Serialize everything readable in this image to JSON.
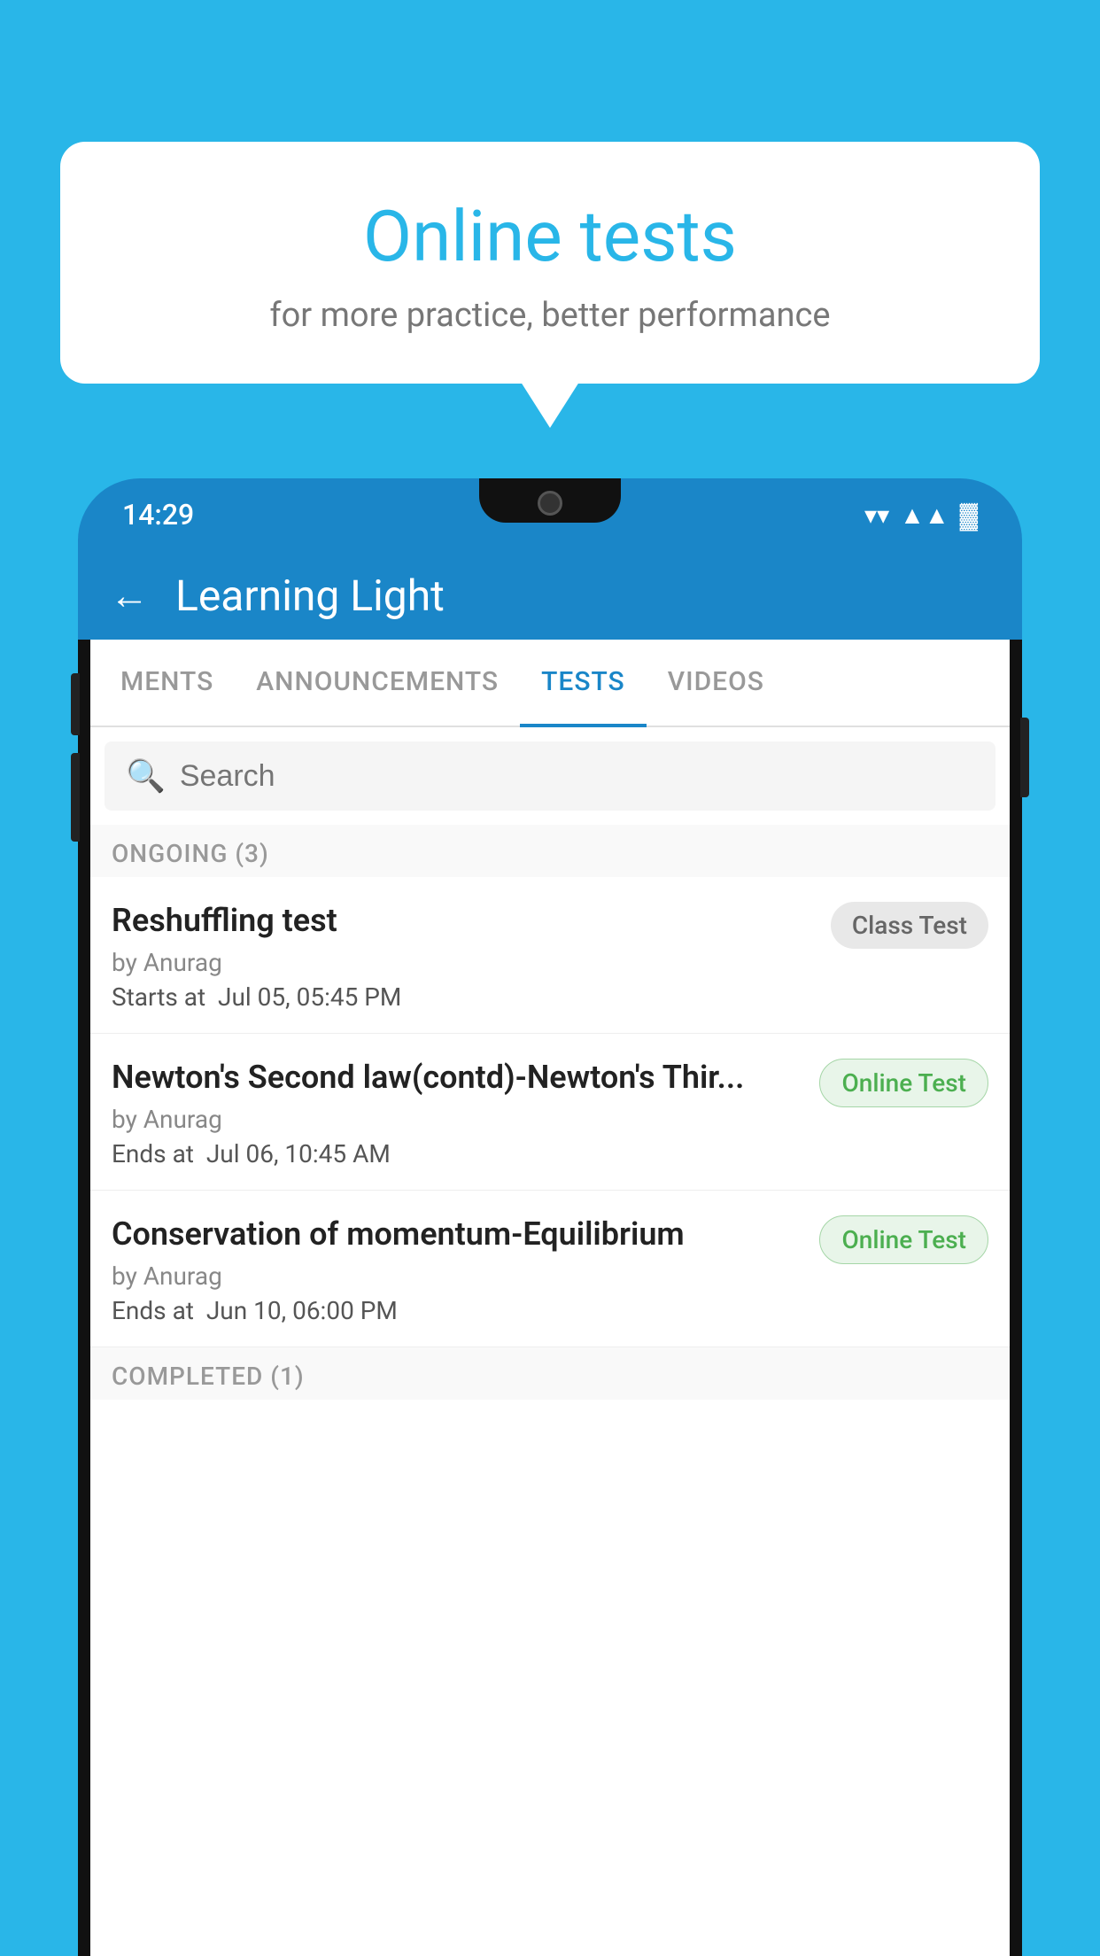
{
  "bubble": {
    "title": "Online tests",
    "subtitle": "for more practice, better performance"
  },
  "phone": {
    "status": {
      "time": "14:29",
      "wifi": "▼",
      "signal": "▲",
      "battery": "▐"
    },
    "header": {
      "back_label": "←",
      "app_name": "Learning Light"
    },
    "tabs": [
      {
        "label": "MENTS",
        "active": false
      },
      {
        "label": "ANNOUNCEMENTS",
        "active": false
      },
      {
        "label": "TESTS",
        "active": true
      },
      {
        "label": "VIDEOS",
        "active": false
      }
    ],
    "search": {
      "placeholder": "Search"
    },
    "ongoing_section": {
      "label": "ONGOING (3)"
    },
    "tests": [
      {
        "name": "Reshuffling test",
        "author": "by Anurag",
        "time_label": "Starts at",
        "time_value": "Jul 05, 05:45 PM",
        "badge": "Class Test",
        "badge_type": "class"
      },
      {
        "name": "Newton's Second law(contd)-Newton's Thir...",
        "author": "by Anurag",
        "time_label": "Ends at",
        "time_value": "Jul 06, 10:45 AM",
        "badge": "Online Test",
        "badge_type": "online"
      },
      {
        "name": "Conservation of momentum-Equilibrium",
        "author": "by Anurag",
        "time_label": "Ends at",
        "time_value": "Jun 10, 06:00 PM",
        "badge": "Online Test",
        "badge_type": "online"
      }
    ],
    "completed_section": {
      "label": "COMPLETED (1)"
    }
  }
}
